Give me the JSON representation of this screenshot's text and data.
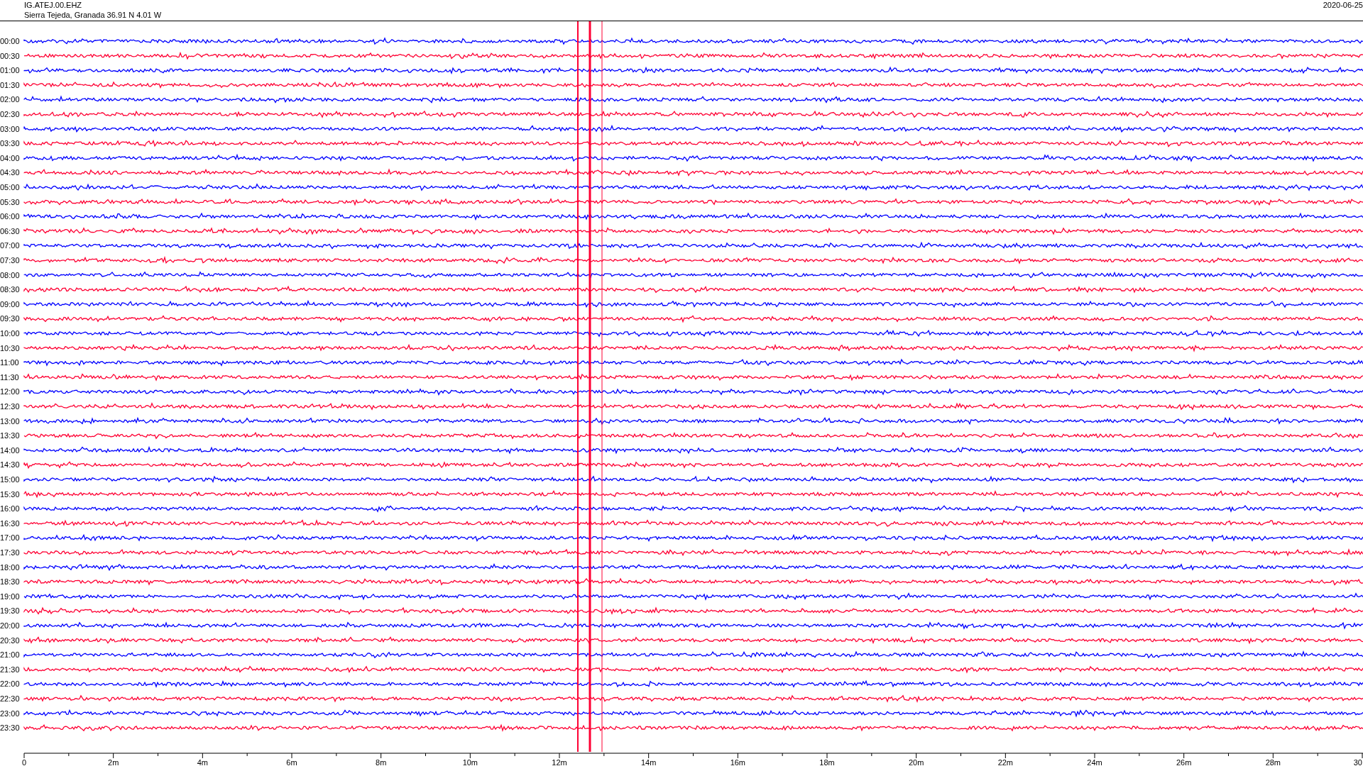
{
  "header": {
    "station": "IG.ATEJ.00.EHZ",
    "location": "Sierra Tejeda, Granada  36.91 N 4.01 W",
    "date": "2020-06-25"
  },
  "traces": [
    {
      "label": "00:00",
      "color": "#0000ff"
    },
    {
      "label": "00:30",
      "color": "#ff0033"
    },
    {
      "label": "01:00",
      "color": "#0000ff"
    },
    {
      "label": "01:30",
      "color": "#ff0033"
    },
    {
      "label": "02:00",
      "color": "#0000ff"
    },
    {
      "label": "02:30",
      "color": "#ff0033"
    },
    {
      "label": "03:00",
      "color": "#0000ff"
    },
    {
      "label": "03:30",
      "color": "#ff0033"
    },
    {
      "label": "04:00",
      "color": "#0000ff"
    },
    {
      "label": "04:30",
      "color": "#ff0033"
    },
    {
      "label": "05:00",
      "color": "#0000ff"
    },
    {
      "label": "05:30",
      "color": "#ff0033"
    },
    {
      "label": "06:00",
      "color": "#0000ff"
    },
    {
      "label": "06:30",
      "color": "#ff0033"
    },
    {
      "label": "07:00",
      "color": "#0000ff"
    },
    {
      "label": "07:30",
      "color": "#ff0033"
    },
    {
      "label": "08:00",
      "color": "#0000ff"
    },
    {
      "label": "08:30",
      "color": "#ff0033"
    },
    {
      "label": "09:00",
      "color": "#0000ff"
    },
    {
      "label": "09:30",
      "color": "#ff0033"
    },
    {
      "label": "10:00",
      "color": "#0000ff"
    },
    {
      "label": "10:30",
      "color": "#ff0033"
    },
    {
      "label": "11:00",
      "color": "#0000ff"
    },
    {
      "label": "11:30",
      "color": "#ff0033"
    },
    {
      "label": "12:00",
      "color": "#0000ff"
    },
    {
      "label": "12:30",
      "color": "#ff0033"
    },
    {
      "label": "13:00",
      "color": "#0000ff"
    },
    {
      "label": "13:30",
      "color": "#ff0033"
    },
    {
      "label": "14:00",
      "color": "#0000ff"
    },
    {
      "label": "14:30",
      "color": "#ff0033"
    },
    {
      "label": "15:00",
      "color": "#0000ff"
    },
    {
      "label": "15:30",
      "color": "#ff0033"
    },
    {
      "label": "16:00",
      "color": "#0000ff"
    },
    {
      "label": "16:30",
      "color": "#ff0033"
    },
    {
      "label": "17:00",
      "color": "#0000ff"
    },
    {
      "label": "17:30",
      "color": "#ff0033"
    },
    {
      "label": "18:00",
      "color": "#0000ff"
    },
    {
      "label": "18:30",
      "color": "#ff0033"
    },
    {
      "label": "19:00",
      "color": "#0000ff"
    },
    {
      "label": "19:30",
      "color": "#ff0033"
    },
    {
      "label": "20:00",
      "color": "#0000ff"
    },
    {
      "label": "20:30",
      "color": "#ff0033"
    },
    {
      "label": "21:00",
      "color": "#0000ff"
    },
    {
      "label": "21:30",
      "color": "#ff0033"
    },
    {
      "label": "22:00",
      "color": "#0000ff"
    },
    {
      "label": "22:30",
      "color": "#ff0033"
    },
    {
      "label": "23:00",
      "color": "#0000ff"
    },
    {
      "label": "23:30",
      "color": "#ff0033"
    }
  ],
  "x_axis": {
    "tick_labels": [
      "0",
      "2m",
      "4m",
      "6m",
      "8m",
      "10m",
      "12m",
      "14m",
      "16m",
      "18m",
      "20m",
      "22m",
      "24m",
      "26m",
      "28m",
      "30"
    ]
  }
}
